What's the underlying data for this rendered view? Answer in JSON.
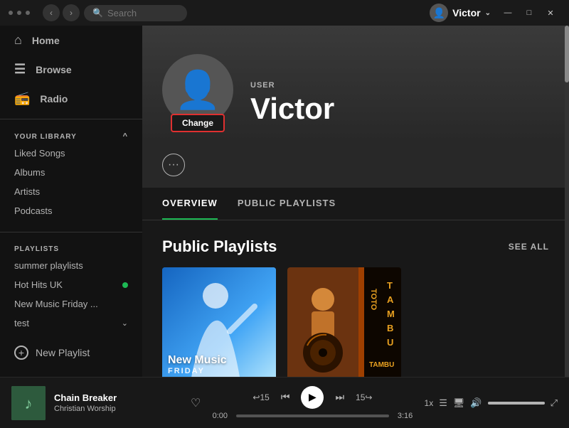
{
  "titlebar": {
    "dots": [
      "dot1",
      "dot2",
      "dot3"
    ],
    "back_label": "‹",
    "forward_label": "›",
    "search_placeholder": "Search",
    "user_name": "Victor",
    "chevron": "⌄",
    "window_minimize": "—",
    "window_maximize": "□",
    "window_close": "✕"
  },
  "sidebar": {
    "nav_items": [
      {
        "id": "home",
        "label": "Home",
        "icon": "⌂"
      },
      {
        "id": "browse",
        "label": "Browse",
        "icon": "⊞"
      },
      {
        "id": "radio",
        "label": "Radio",
        "icon": "((·))"
      }
    ],
    "library_section": "YOUR LIBRARY",
    "library_items": [
      {
        "label": "Liked Songs",
        "id": "liked-songs"
      },
      {
        "label": "Albums",
        "id": "albums"
      },
      {
        "label": "Artists",
        "id": "artists"
      },
      {
        "label": "Podcasts",
        "id": "podcasts"
      }
    ],
    "playlists_section": "PLAYLISTS",
    "playlists": [
      {
        "label": "summer playlists",
        "id": "summer-playlists",
        "has_dot": false
      },
      {
        "label": "Hot Hits UK",
        "id": "hot-hits-uk",
        "has_dot": true
      },
      {
        "label": "New Music Friday ...",
        "id": "new-music-friday",
        "has_dot": false
      },
      {
        "label": "test",
        "id": "test",
        "has_chevron": true
      }
    ],
    "new_playlist_label": "New Playlist"
  },
  "profile": {
    "type_label": "USER",
    "name": "Victor",
    "change_btn_label": "Change"
  },
  "tabs": [
    {
      "id": "overview",
      "label": "OVERVIEW",
      "active": true
    },
    {
      "id": "public-playlists",
      "label": "PUBLIC PLAYLISTS",
      "active": false
    }
  ],
  "public_playlists": {
    "section_title": "Public Playlists",
    "see_all_label": "SEE ALL",
    "cards": [
      {
        "id": "new-music-friday",
        "title": "New Music",
        "subtitle": "FRIDAY",
        "type": "nmf"
      },
      {
        "id": "tambu",
        "title": "TAMBU",
        "type": "tambu"
      }
    ]
  },
  "now_playing": {
    "track_title": "Chain Breaker",
    "artist": "Christian Worship",
    "current_time": "0:00",
    "total_time": "3:16",
    "progress_pct": 0,
    "volume_pct": 100
  }
}
